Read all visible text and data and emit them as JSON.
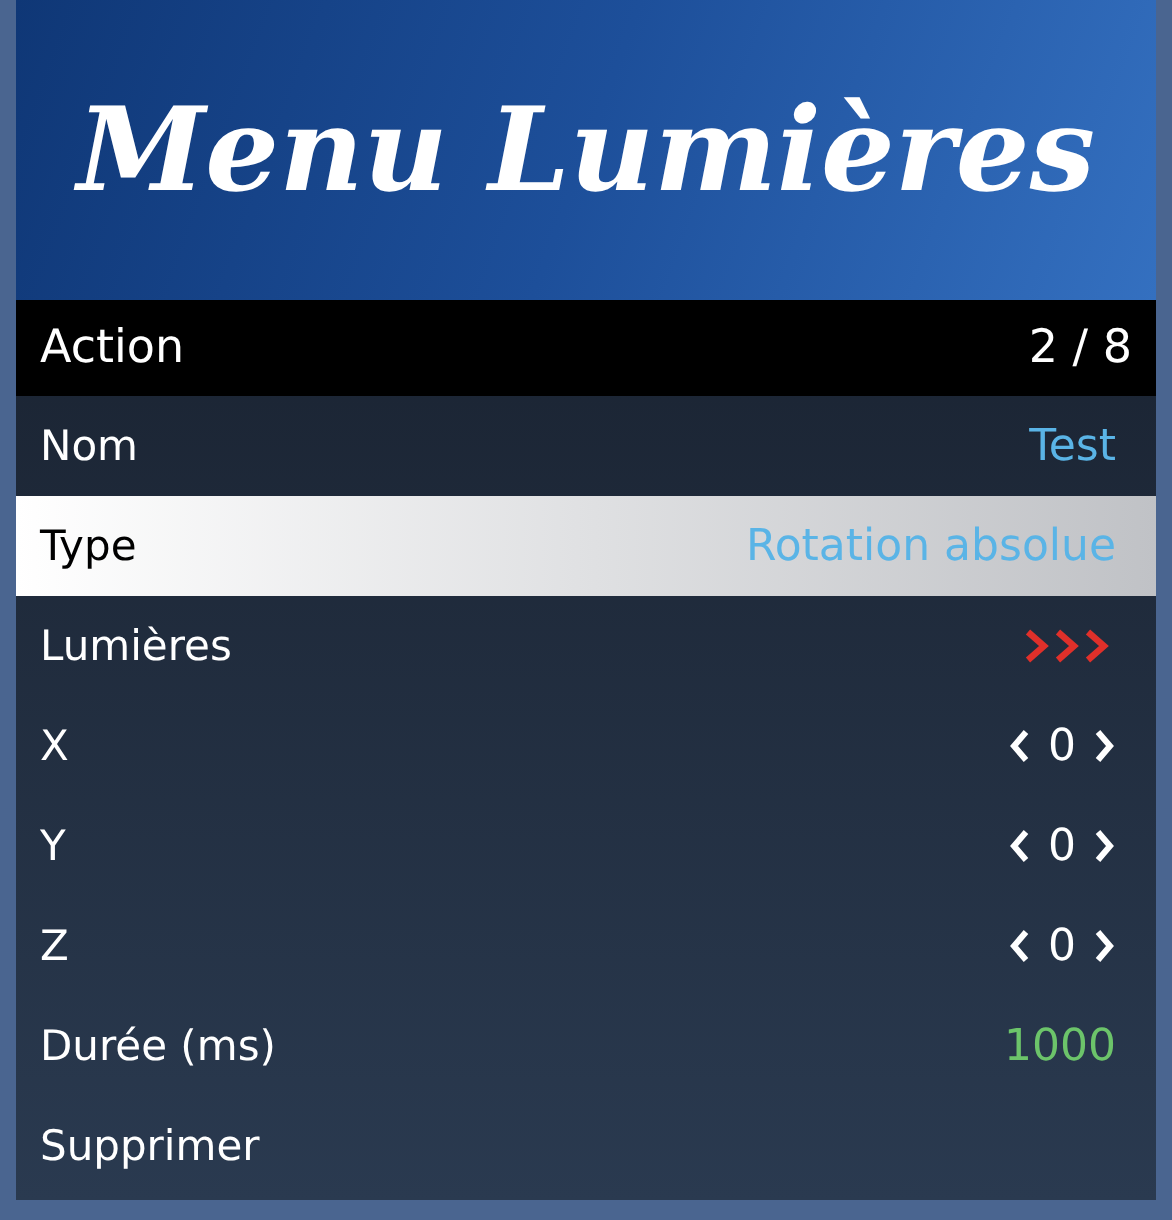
{
  "header": {
    "title": "Menu Lumières"
  },
  "subtitle": {
    "label": "Action",
    "counter": "2 / 8"
  },
  "items": [
    {
      "kind": "value",
      "label": "Nom",
      "value": "Test",
      "color": "#5ab4e6",
      "selected": false
    },
    {
      "kind": "value",
      "label": "Type",
      "value": "Rotation absolue",
      "color": "#5ab4e6",
      "selected": true
    },
    {
      "kind": "submenu",
      "label": "Lumières",
      "selected": false
    },
    {
      "kind": "stepper",
      "label": "X",
      "value": "0",
      "selected": false
    },
    {
      "kind": "stepper",
      "label": "Y",
      "value": "0",
      "selected": false
    },
    {
      "kind": "stepper",
      "label": "Z",
      "value": "0",
      "selected": false
    },
    {
      "kind": "value",
      "label": "Durée (ms)",
      "value": "1000",
      "color": "#6cc46a",
      "selected": false
    },
    {
      "kind": "plain",
      "label": "Supprimer",
      "selected": false
    }
  ]
}
